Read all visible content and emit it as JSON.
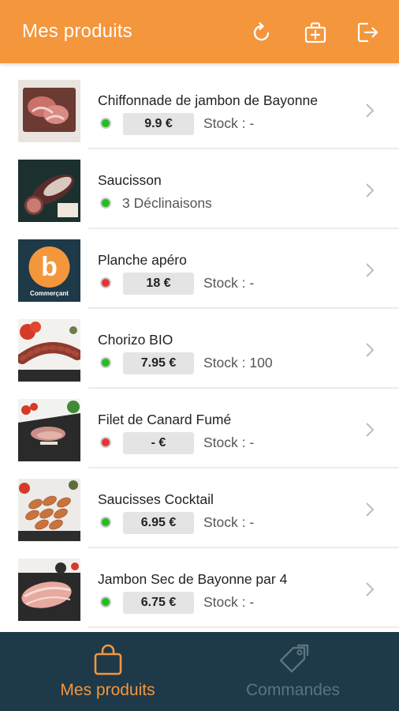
{
  "header": {
    "title": "Mes produits",
    "actions": [
      {
        "icon": "refresh-icon"
      },
      {
        "icon": "add-product-icon"
      },
      {
        "icon": "logout-icon"
      }
    ],
    "color": "#f4963c"
  },
  "products": [
    {
      "name": "Chiffonnade de jambon de Bayonne",
      "status": "green",
      "price": "9.9 €",
      "stock": "Stock : -"
    },
    {
      "name": "Saucisson",
      "status": "green",
      "variants": "3 Déclinaisons"
    },
    {
      "name": "Planche apéro",
      "status": "red",
      "price": "18 €",
      "stock": "Stock : -",
      "logo_text": "Commerçant"
    },
    {
      "name": "Chorizo BIO",
      "status": "green",
      "price": "7.95 €",
      "stock": "Stock : 100"
    },
    {
      "name": "Filet de Canard Fumé",
      "status": "red",
      "price": "- €",
      "stock": "Stock : -"
    },
    {
      "name": "Saucisses Cocktail",
      "status": "green",
      "price": "6.95 €",
      "stock": "Stock : -"
    },
    {
      "name": "Jambon Sec de Bayonne par 4",
      "status": "green",
      "price": "6.75 €",
      "stock": "Stock : -"
    }
  ],
  "nav": {
    "tabs": [
      {
        "label": "Mes produits",
        "icon": "shopping-bag-icon",
        "active": true
      },
      {
        "label": "Commandes",
        "icon": "tags-icon",
        "active": false
      }
    ],
    "background": "#1e3948",
    "active_color": "#f4963c"
  }
}
